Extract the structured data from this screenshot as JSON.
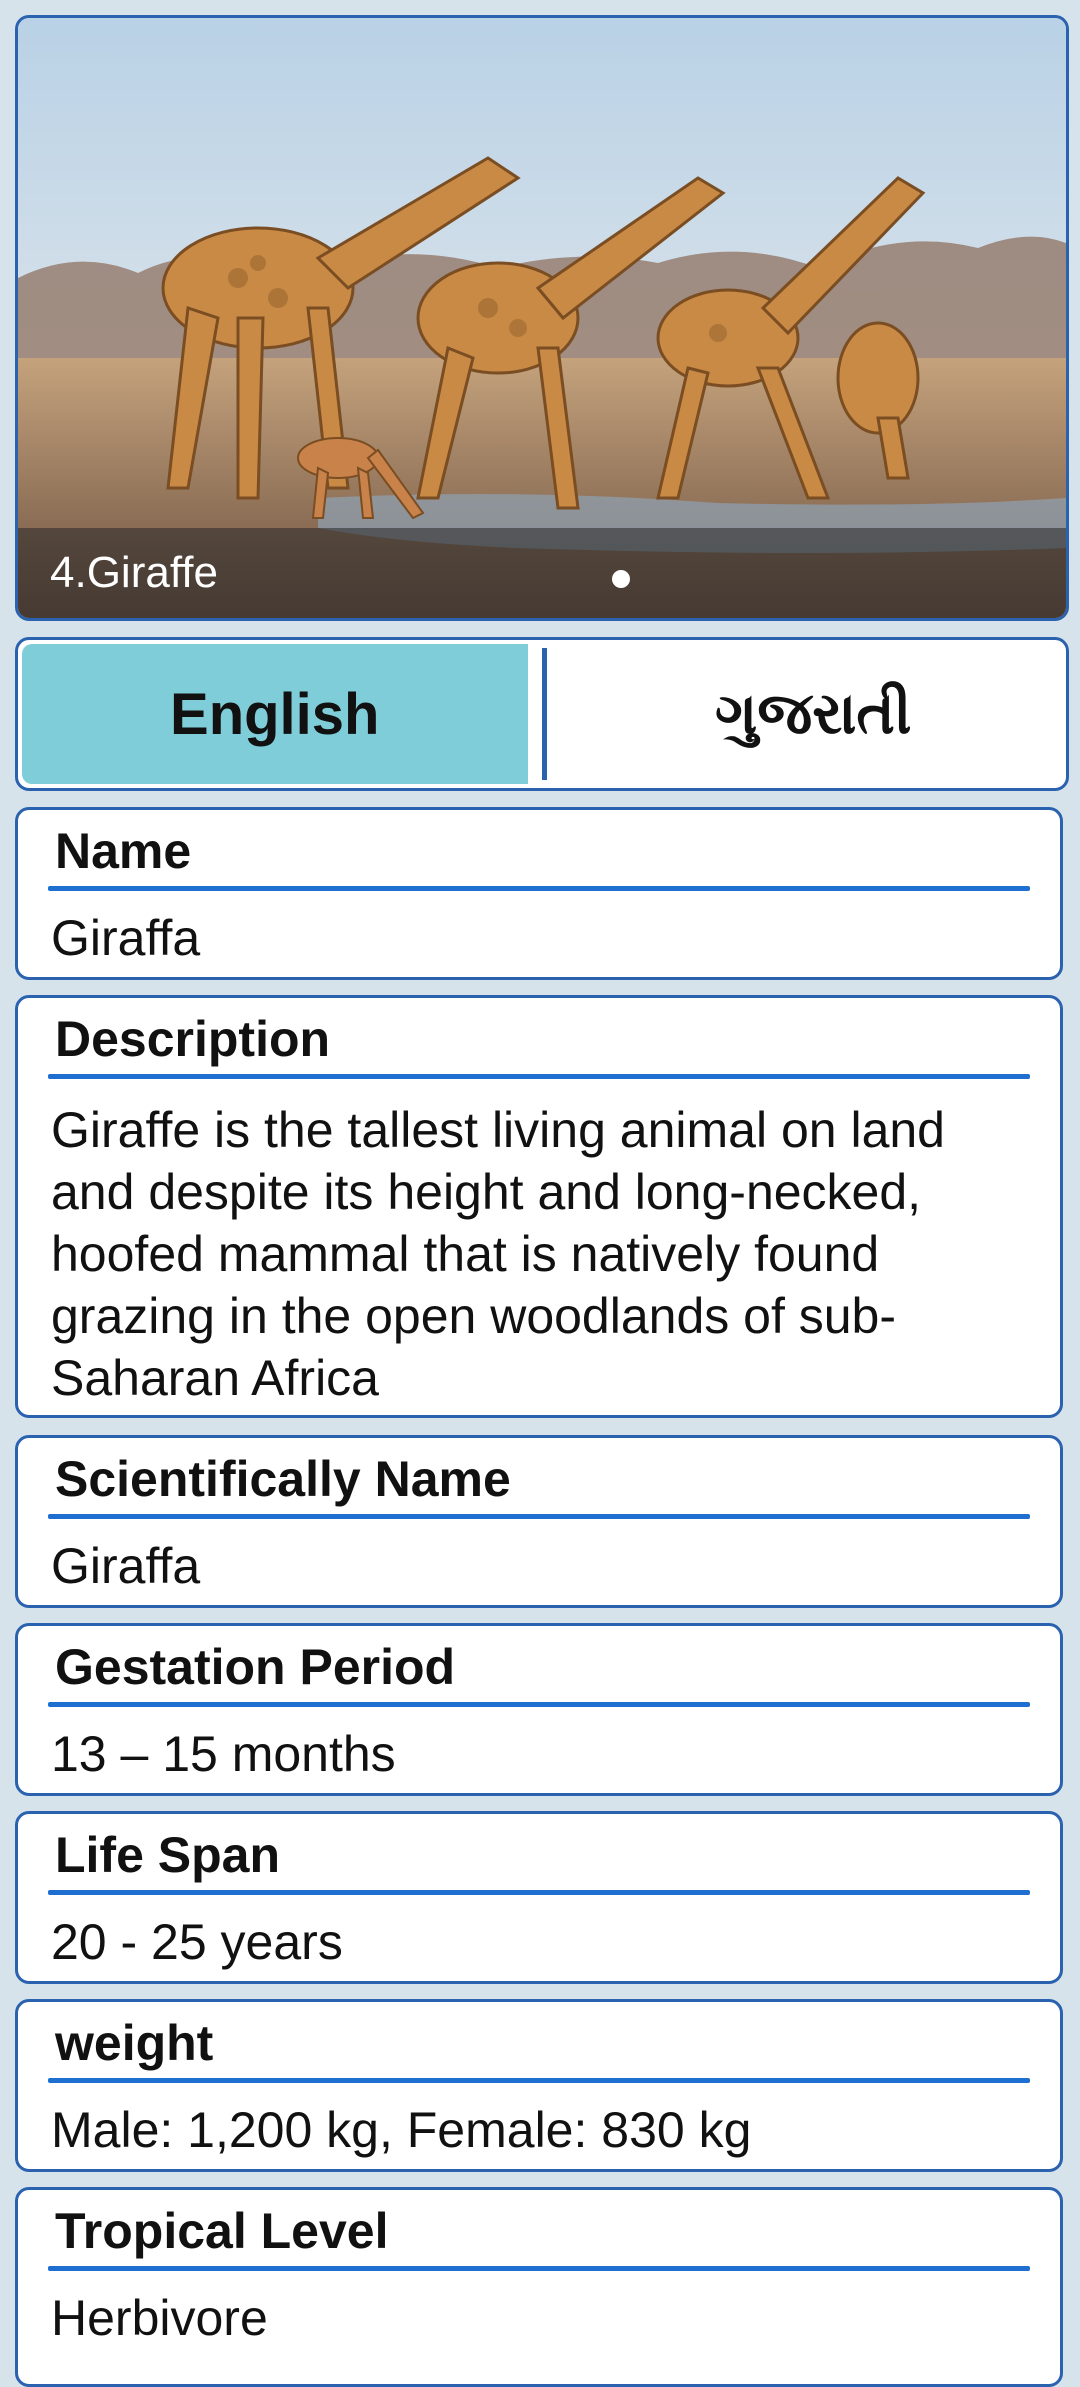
{
  "hero": {
    "title": "4.Giraffe"
  },
  "language_tabs": [
    {
      "label": "English",
      "active": true
    },
    {
      "label": "ગુજરાતી",
      "active": false
    }
  ],
  "fields": {
    "name": {
      "label": "Name",
      "value": "Giraffa"
    },
    "description": {
      "label": "Description",
      "value": "Giraffe is the tallest living animal on land and despite its height and long-necked, hoofed mammal that is natively found grazing in the open woodlands of sub-Saharan Africa"
    },
    "scientific": {
      "label": "Scientifically Name",
      "value": "Giraffa"
    },
    "gestation": {
      "label": "Gestation Period",
      "value": "13 – 15 months"
    },
    "lifespan": {
      "label": "Life Span",
      "value": "20 - 25 years"
    },
    "weight": {
      "label": "weight",
      "value": "Male: 1,200 kg, Female: 830 kg"
    },
    "tropical": {
      "label": "Tropical Level",
      "value": "Herbivore"
    }
  }
}
